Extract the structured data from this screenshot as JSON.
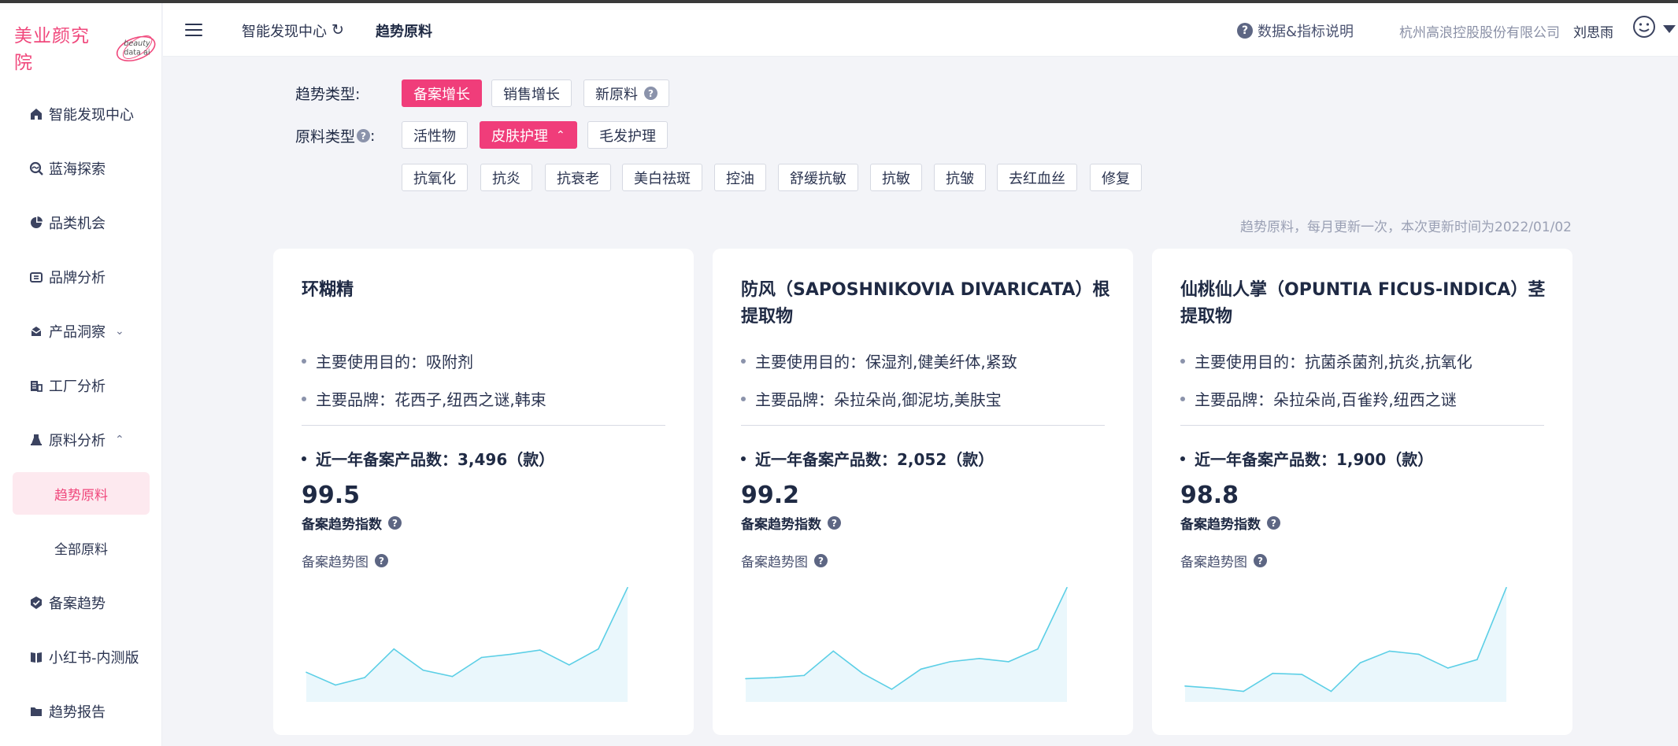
{
  "brand": {
    "logo_text": "美业颜究院",
    "logo_small": "beauty data ai",
    "accent": "#f03d7a"
  },
  "sidebar": {
    "items": [
      {
        "label": "智能发现中心",
        "icon": "home-icon"
      },
      {
        "label": "蓝海探索",
        "icon": "explore-icon"
      },
      {
        "label": "品类机会",
        "icon": "pie-chart-icon"
      },
      {
        "label": "品牌分析",
        "icon": "brand-icon"
      },
      {
        "label": "产品洞察",
        "icon": "product-icon",
        "expanded": false
      },
      {
        "label": "工厂分析",
        "icon": "factory-icon"
      },
      {
        "label": "原料分析",
        "icon": "ingredient-icon",
        "expanded": true
      },
      {
        "label": "备案趋势",
        "icon": "check-badge-icon"
      },
      {
        "label": "小红书-内测版",
        "icon": "book-icon"
      },
      {
        "label": "趋势报告",
        "icon": "folder-icon"
      }
    ],
    "sub_items": [
      {
        "label": "趋势原料",
        "active": true
      },
      {
        "label": "全部原料",
        "active": false
      }
    ]
  },
  "header": {
    "crumb_home": "智能发现中心",
    "crumb_current": "趋势原料",
    "help": "数据&指标说明",
    "company": "杭州高浪控股股份有限公司",
    "user": "刘思雨"
  },
  "filters": {
    "trend_label": "趋势类型:",
    "trend_options": [
      {
        "label": "备案增长",
        "active": true
      },
      {
        "label": "销售增长",
        "active": false
      },
      {
        "label": "新原料",
        "active": false
      }
    ],
    "material_label": "原料类型",
    "material_options": [
      {
        "label": "活性物",
        "active": false
      },
      {
        "label": "皮肤护理",
        "active": true
      },
      {
        "label": "毛发护理",
        "active": false
      }
    ],
    "sub_options": [
      "抗氧化",
      "抗炎",
      "抗衰老",
      "美白祛斑",
      "控油",
      "舒缓抗敏",
      "抗敏",
      "抗皱",
      "去红血丝",
      "修复"
    ]
  },
  "update_note": "趋势原料，每月更新一次，本次更新时间为2022/01/02",
  "cards": [
    {
      "title": "环糊精",
      "purpose": "主要使用目的：吸附剂",
      "brands": "主要品牌：花西子,纽西之谜,韩束",
      "count": "近一年备案产品数：3,496（款）",
      "score": "99.5",
      "score_label": "备案趋势指数",
      "chart_label": "备案趋势图"
    },
    {
      "title": "防风（SAPOSHNIKOVIA DIVARICATA）根提取物",
      "purpose": "主要使用目的：保湿剂,健美纤体,紧致",
      "brands": "主要品牌：朵拉朵尚,御泥坊,美肤宝",
      "count": "近一年备案产品数：2,052（款）",
      "score": "99.2",
      "score_label": "备案趋势指数",
      "chart_label": "备案趋势图"
    },
    {
      "title": "仙桃仙人掌（OPUNTIA FICUS-INDICA）茎提取物",
      "purpose": "主要使用目的：抗菌杀菌剂,抗炎,抗氧化",
      "brands": "主要品牌：朵拉朵尚,百雀羚,纽西之谜",
      "count": "近一年备案产品数：1,900（款）",
      "score": "98.8",
      "score_label": "备案趋势指数",
      "chart_label": "备案趋势图"
    }
  ],
  "chart_data": [
    {
      "type": "area",
      "values": [
        28,
        16,
        23,
        50,
        30,
        24,
        42,
        45,
        49,
        35,
        50,
        108
      ],
      "ylim": [
        0,
        110
      ],
      "color": "#5ccfe6"
    },
    {
      "type": "area",
      "values": [
        22,
        23,
        25,
        48,
        27,
        12,
        31,
        38,
        41,
        38,
        50,
        108
      ],
      "ylim": [
        0,
        110
      ],
      "color": "#5ccfe6"
    },
    {
      "type": "area",
      "values": [
        15,
        13,
        10,
        27,
        26,
        10,
        37,
        48,
        45,
        32,
        40,
        108
      ],
      "ylim": [
        0,
        110
      ],
      "color": "#5ccfe6"
    }
  ]
}
